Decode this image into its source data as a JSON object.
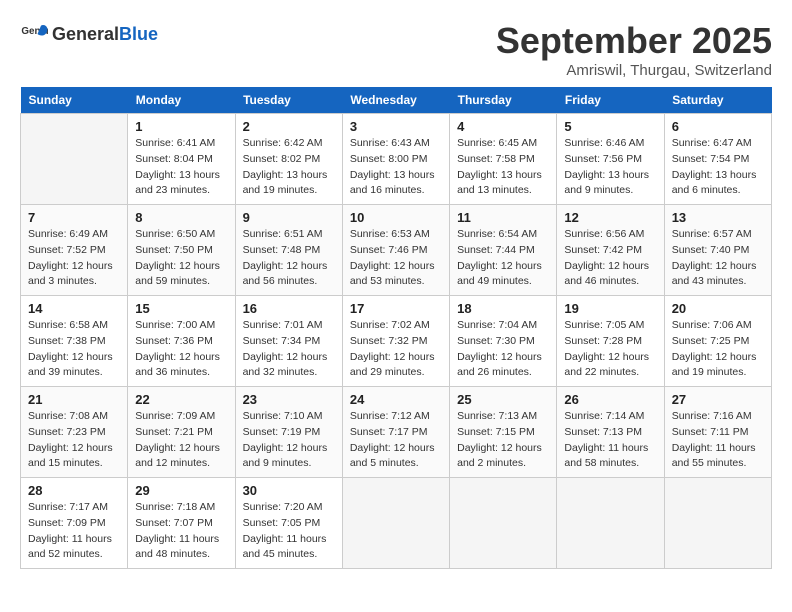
{
  "header": {
    "logo_general": "General",
    "logo_blue": "Blue",
    "month_year": "September 2025",
    "location": "Amriswil, Thurgau, Switzerland"
  },
  "days_of_week": [
    "Sunday",
    "Monday",
    "Tuesday",
    "Wednesday",
    "Thursday",
    "Friday",
    "Saturday"
  ],
  "weeks": [
    [
      {
        "day": "",
        "sunrise": "",
        "sunset": "",
        "daylight": ""
      },
      {
        "day": "1",
        "sunrise": "Sunrise: 6:41 AM",
        "sunset": "Sunset: 8:04 PM",
        "daylight": "Daylight: 13 hours and 23 minutes."
      },
      {
        "day": "2",
        "sunrise": "Sunrise: 6:42 AM",
        "sunset": "Sunset: 8:02 PM",
        "daylight": "Daylight: 13 hours and 19 minutes."
      },
      {
        "day": "3",
        "sunrise": "Sunrise: 6:43 AM",
        "sunset": "Sunset: 8:00 PM",
        "daylight": "Daylight: 13 hours and 16 minutes."
      },
      {
        "day": "4",
        "sunrise": "Sunrise: 6:45 AM",
        "sunset": "Sunset: 7:58 PM",
        "daylight": "Daylight: 13 hours and 13 minutes."
      },
      {
        "day": "5",
        "sunrise": "Sunrise: 6:46 AM",
        "sunset": "Sunset: 7:56 PM",
        "daylight": "Daylight: 13 hours and 9 minutes."
      },
      {
        "day": "6",
        "sunrise": "Sunrise: 6:47 AM",
        "sunset": "Sunset: 7:54 PM",
        "daylight": "Daylight: 13 hours and 6 minutes."
      }
    ],
    [
      {
        "day": "7",
        "sunrise": "Sunrise: 6:49 AM",
        "sunset": "Sunset: 7:52 PM",
        "daylight": "Daylight: 12 hours and 3 minutes."
      },
      {
        "day": "8",
        "sunrise": "Sunrise: 6:50 AM",
        "sunset": "Sunset: 7:50 PM",
        "daylight": "Daylight: 12 hours and 59 minutes."
      },
      {
        "day": "9",
        "sunrise": "Sunrise: 6:51 AM",
        "sunset": "Sunset: 7:48 PM",
        "daylight": "Daylight: 12 hours and 56 minutes."
      },
      {
        "day": "10",
        "sunrise": "Sunrise: 6:53 AM",
        "sunset": "Sunset: 7:46 PM",
        "daylight": "Daylight: 12 hours and 53 minutes."
      },
      {
        "day": "11",
        "sunrise": "Sunrise: 6:54 AM",
        "sunset": "Sunset: 7:44 PM",
        "daylight": "Daylight: 12 hours and 49 minutes."
      },
      {
        "day": "12",
        "sunrise": "Sunrise: 6:56 AM",
        "sunset": "Sunset: 7:42 PM",
        "daylight": "Daylight: 12 hours and 46 minutes."
      },
      {
        "day": "13",
        "sunrise": "Sunrise: 6:57 AM",
        "sunset": "Sunset: 7:40 PM",
        "daylight": "Daylight: 12 hours and 43 minutes."
      }
    ],
    [
      {
        "day": "14",
        "sunrise": "Sunrise: 6:58 AM",
        "sunset": "Sunset: 7:38 PM",
        "daylight": "Daylight: 12 hours and 39 minutes."
      },
      {
        "day": "15",
        "sunrise": "Sunrise: 7:00 AM",
        "sunset": "Sunset: 7:36 PM",
        "daylight": "Daylight: 12 hours and 36 minutes."
      },
      {
        "day": "16",
        "sunrise": "Sunrise: 7:01 AM",
        "sunset": "Sunset: 7:34 PM",
        "daylight": "Daylight: 12 hours and 32 minutes."
      },
      {
        "day": "17",
        "sunrise": "Sunrise: 7:02 AM",
        "sunset": "Sunset: 7:32 PM",
        "daylight": "Daylight: 12 hours and 29 minutes."
      },
      {
        "day": "18",
        "sunrise": "Sunrise: 7:04 AM",
        "sunset": "Sunset: 7:30 PM",
        "daylight": "Daylight: 12 hours and 26 minutes."
      },
      {
        "day": "19",
        "sunrise": "Sunrise: 7:05 AM",
        "sunset": "Sunset: 7:28 PM",
        "daylight": "Daylight: 12 hours and 22 minutes."
      },
      {
        "day": "20",
        "sunrise": "Sunrise: 7:06 AM",
        "sunset": "Sunset: 7:25 PM",
        "daylight": "Daylight: 12 hours and 19 minutes."
      }
    ],
    [
      {
        "day": "21",
        "sunrise": "Sunrise: 7:08 AM",
        "sunset": "Sunset: 7:23 PM",
        "daylight": "Daylight: 12 hours and 15 minutes."
      },
      {
        "day": "22",
        "sunrise": "Sunrise: 7:09 AM",
        "sunset": "Sunset: 7:21 PM",
        "daylight": "Daylight: 12 hours and 12 minutes."
      },
      {
        "day": "23",
        "sunrise": "Sunrise: 7:10 AM",
        "sunset": "Sunset: 7:19 PM",
        "daylight": "Daylight: 12 hours and 9 minutes."
      },
      {
        "day": "24",
        "sunrise": "Sunrise: 7:12 AM",
        "sunset": "Sunset: 7:17 PM",
        "daylight": "Daylight: 12 hours and 5 minutes."
      },
      {
        "day": "25",
        "sunrise": "Sunrise: 7:13 AM",
        "sunset": "Sunset: 7:15 PM",
        "daylight": "Daylight: 12 hours and 2 minutes."
      },
      {
        "day": "26",
        "sunrise": "Sunrise: 7:14 AM",
        "sunset": "Sunset: 7:13 PM",
        "daylight": "Daylight: 11 hours and 58 minutes."
      },
      {
        "day": "27",
        "sunrise": "Sunrise: 7:16 AM",
        "sunset": "Sunset: 7:11 PM",
        "daylight": "Daylight: 11 hours and 55 minutes."
      }
    ],
    [
      {
        "day": "28",
        "sunrise": "Sunrise: 7:17 AM",
        "sunset": "Sunset: 7:09 PM",
        "daylight": "Daylight: 11 hours and 52 minutes."
      },
      {
        "day": "29",
        "sunrise": "Sunrise: 7:18 AM",
        "sunset": "Sunset: 7:07 PM",
        "daylight": "Daylight: 11 hours and 48 minutes."
      },
      {
        "day": "30",
        "sunrise": "Sunrise: 7:20 AM",
        "sunset": "Sunset: 7:05 PM",
        "daylight": "Daylight: 11 hours and 45 minutes."
      },
      {
        "day": "",
        "sunrise": "",
        "sunset": "",
        "daylight": ""
      },
      {
        "day": "",
        "sunrise": "",
        "sunset": "",
        "daylight": ""
      },
      {
        "day": "",
        "sunrise": "",
        "sunset": "",
        "daylight": ""
      },
      {
        "day": "",
        "sunrise": "",
        "sunset": "",
        "daylight": ""
      }
    ]
  ]
}
